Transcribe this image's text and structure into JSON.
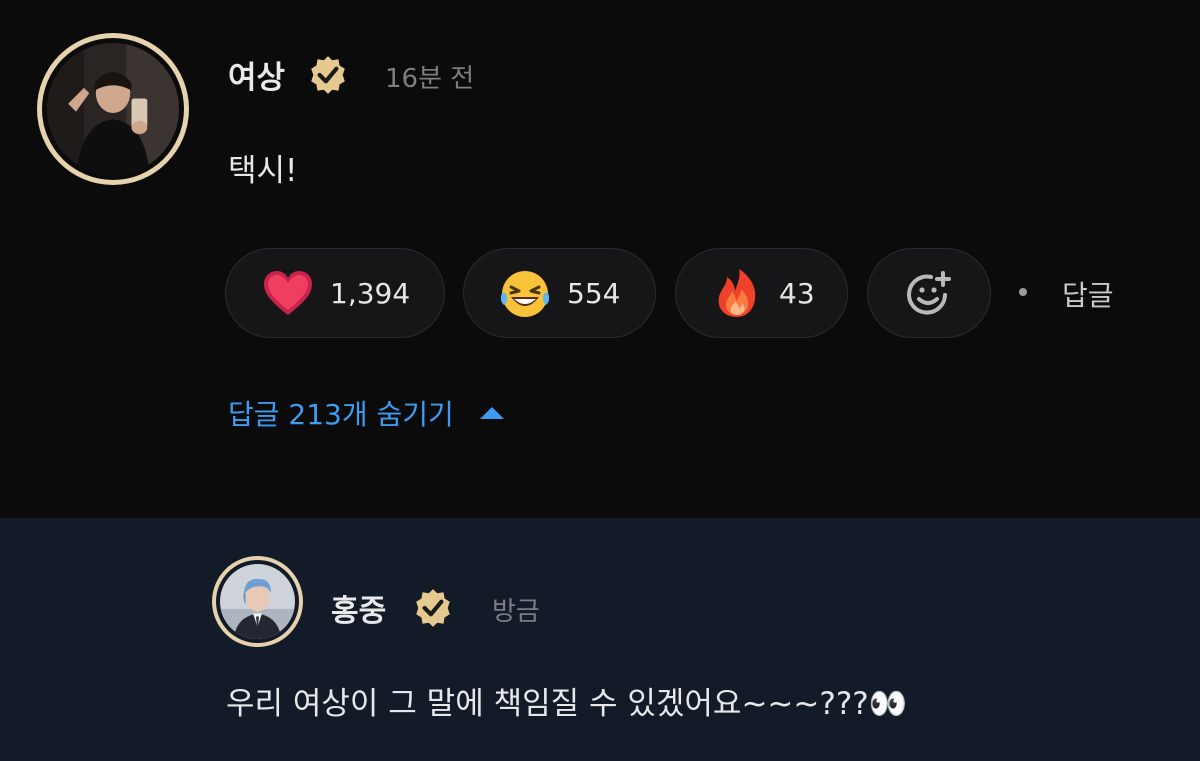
{
  "comment": {
    "username": "여상",
    "timestamp": "16분 전",
    "text": "택시!",
    "avatar": "user-photo",
    "verified": true,
    "reactions": [
      {
        "icon": "heart-icon",
        "count": "1,394"
      },
      {
        "icon": "laughing-tears-icon",
        "count": "554"
      },
      {
        "icon": "fire-icon",
        "count": "43"
      }
    ],
    "add_reaction_icon": "add-reaction-icon",
    "reply_label": "답글",
    "hide_replies_label": "답글 213개 숨기기"
  },
  "reply": {
    "username": "홍중",
    "timestamp": "방금",
    "text": "우리 여상이 그 말에 책임질 수 있겠어요~~~???👀",
    "avatar": "user-photo",
    "verified": true
  },
  "colors": {
    "background": "#0b0b0c",
    "reply_background": "#121b27",
    "accent_link": "#3e9bf0",
    "badge_gold": "#e6c98f",
    "avatar_ring": "#e6d3ad",
    "muted_text": "#7d7d82"
  }
}
